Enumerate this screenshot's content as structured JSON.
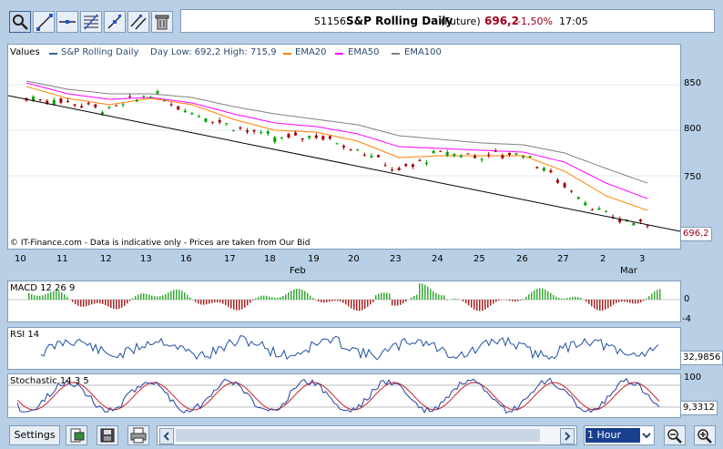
{
  "header": {
    "code": "51156",
    "name": "S&P Rolling Daily",
    "kind": "(Future)",
    "price": "696,2",
    "change": "-1,50%",
    "time": "17:05"
  },
  "toolbar": {
    "icons": [
      "zoom-icon",
      "trendline-icon",
      "horizontal-line-icon",
      "fibonacci-icon",
      "crosshair-icon",
      "parallel-lines-icon",
      "trash-icon"
    ]
  },
  "price_panel": {
    "label": "Values",
    "legend": [
      {
        "text": "S&P Rolling Daily",
        "color": "#336699"
      },
      {
        "text": "Day Low: 692,2 High: 715,9",
        "color": null
      },
      {
        "text": "EMA20",
        "color": "#ff8000"
      },
      {
        "text": "EMA50",
        "color": "#ff00ff"
      },
      {
        "text": "EMA100",
        "color": "#808080"
      }
    ],
    "disclaimer": "© IT-Finance.com - Data is indicative only - Prices are taken from Our Bid",
    "last_value": "696,2",
    "y_ticks": [
      "850",
      "800",
      "750"
    ]
  },
  "x_axis": {
    "days": [
      "10",
      "11",
      "12",
      "13",
      "16",
      "17",
      "18",
      "19",
      "20",
      "23",
      "24",
      "25",
      "26",
      "27",
      "2",
      "3"
    ],
    "months": [
      "Feb",
      "Mar"
    ]
  },
  "macd_panel": {
    "label": "MACD 12 26 9",
    "y_ticks": [
      "0",
      "-4"
    ]
  },
  "rsi_panel": {
    "label": "RSI 14",
    "value": "32,9856"
  },
  "stoch_panel": {
    "label": "Stochastic 14 3 5",
    "value": "9,3312",
    "top_tick": "100"
  },
  "bottom": {
    "settings_label": "Settings",
    "timeframe": "1 Hour"
  },
  "colors": {
    "price_up": "#00a000",
    "price_down": "#a00000",
    "macd_up": "#33aa33",
    "macd_down": "#aa2222",
    "rsi": "#1f4f9f",
    "stoch_k": "#1f3f9f",
    "stoch_d": "#cc2222"
  },
  "chart_data": {
    "type": "line",
    "title": "S&P Rolling Daily",
    "categories": [
      "10",
      "11",
      "12",
      "13",
      "16",
      "17",
      "18",
      "19",
      "20",
      "23",
      "24",
      "25",
      "26",
      "27",
      "2",
      "3"
    ],
    "ylim": [
      690,
      870
    ],
    "series": [
      {
        "name": "S&P Rolling Daily",
        "values": [
          835,
          832,
          822,
          840,
          820,
          805,
          790,
          795,
          780,
          755,
          775,
          772,
          775,
          740,
          705,
          696
        ]
      },
      {
        "name": "EMA20",
        "values": [
          848,
          835,
          828,
          835,
          828,
          812,
          800,
          798,
          788,
          770,
          772,
          772,
          772,
          755,
          728,
          712
        ]
      },
      {
        "name": "EMA50",
        "values": [
          852,
          840,
          834,
          836,
          830,
          818,
          808,
          804,
          796,
          782,
          780,
          778,
          776,
          765,
          742,
          725
        ]
      },
      {
        "name": "EMA100",
        "values": [
          854,
          845,
          840,
          840,
          836,
          826,
          818,
          812,
          806,
          794,
          790,
          786,
          784,
          775,
          758,
          742
        ]
      }
    ],
    "trendline": {
      "start": [
        10,
        830
      ],
      "end": [
        3,
        693
      ]
    },
    "last_value": 696.2,
    "day_low": 692.2,
    "day_high": 715.9
  }
}
